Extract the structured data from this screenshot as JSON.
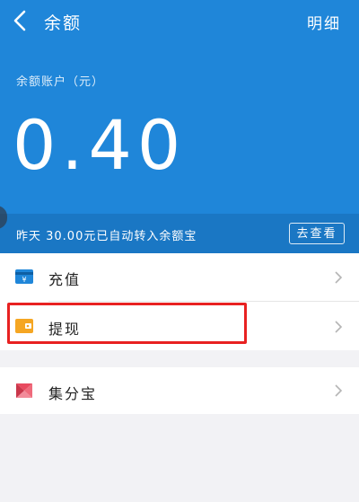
{
  "topbar": {
    "title": "余额",
    "detail_label": "明细",
    "back_icon": "chevron-left-icon"
  },
  "balance": {
    "label": "余额账户（元）",
    "value": "0.40"
  },
  "notice": {
    "text": "昨天 30.00元已自动转入余额宝",
    "button_label": "去查看"
  },
  "menu": [
    {
      "label": "充值",
      "icon": "card-icon",
      "icon_color": "#1f86d9"
    },
    {
      "label": "提现",
      "icon": "wallet-icon",
      "icon_color": "#f5a623"
    },
    {
      "label": "集分宝",
      "icon": "jifenbao-icon",
      "icon_color": "#e84a5f"
    }
  ],
  "colors": {
    "header_bg": "#1f86d9",
    "notice_bg": "#1a77c4",
    "highlight": "#e82121"
  }
}
